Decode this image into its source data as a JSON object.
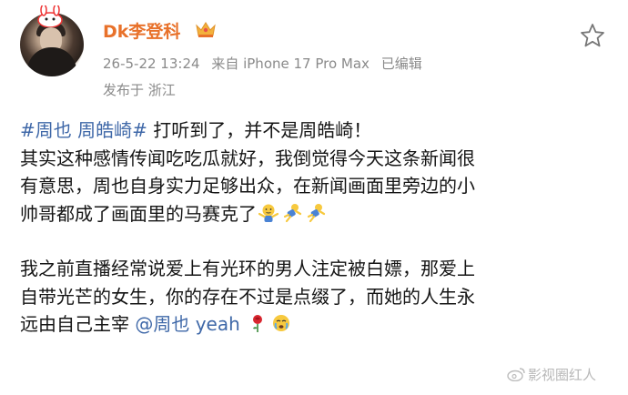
{
  "post": {
    "username": "Dk李登科",
    "timestamp": "26-5-22 13:24",
    "source": "来自 iPhone 17 Pro Max",
    "edited": "已编辑",
    "location": "发布于 浙江",
    "line1_topic": "#周也 周皓崎#",
    "line1_text": " 打听到了，并不是周皓崎！",
    "line2": "其实这种感情传闻吃吃瓜就好，我倒觉得今天这条新闻很",
    "line3": "有意思，周也自身实力足够出众，在新闻画面里旁边的小",
    "line4": "帅哥都成了画面里的马赛克了",
    "line5": "我之前直播经常说爱上有光环的男人注定被白嫖，那爱上",
    "line6": "自带光芒的女生，你的存在不过是点缀了，而她的人生永",
    "line7_text": "远由自己主宰 ",
    "line7_mention": "@周也",
    "line7_suffix": " yeah"
  },
  "icons": {
    "avatar_badge": "rabbit-badge-icon",
    "crown": "crown-icon",
    "favorite": "star-icon",
    "emoji_shrug": "shrug-emoji-icon",
    "emoji_jump": "jumping-figure-emoji-icon",
    "emoji_rose": "rose-emoji-icon",
    "emoji_cry": "teary-face-emoji-icon"
  },
  "watermark": {
    "text": "影视圈红人"
  },
  "colors": {
    "username": "#e8712a",
    "link": "#3f68a8",
    "meta": "#8a8a8a"
  }
}
